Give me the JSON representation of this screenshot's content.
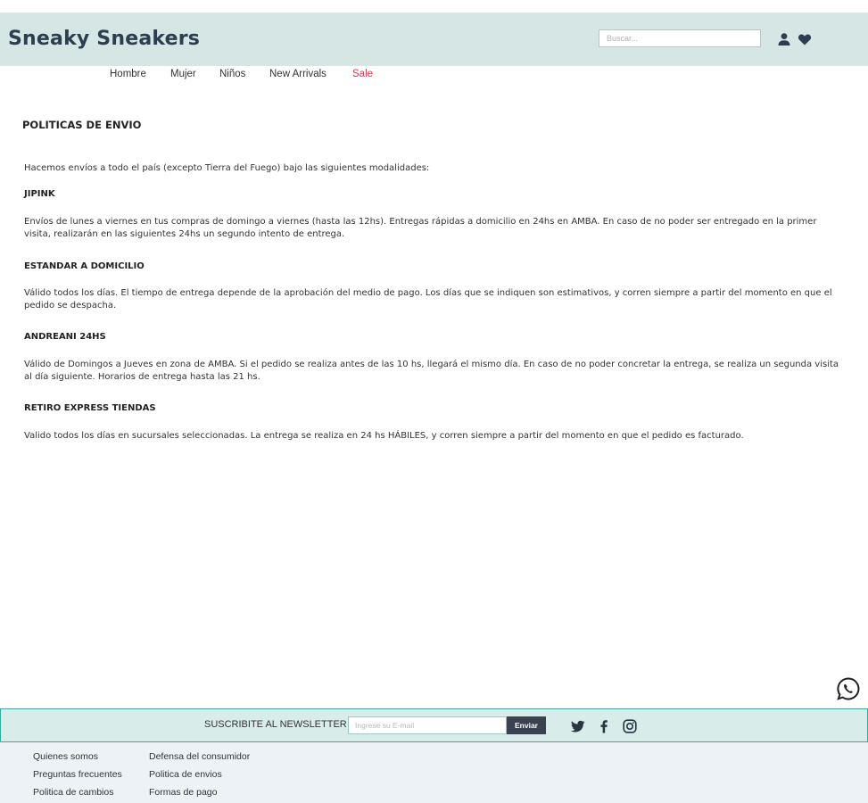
{
  "brand": "Sneaky Sneakers",
  "search": {
    "placeholder": "Buscar..."
  },
  "nav": [
    "Hombre",
    "Mujer",
    "Niños",
    "New Arrivals",
    "Sale"
  ],
  "page": {
    "title": "POLITICAS DE ENVIO",
    "intro": "Hacemos envíos a todo el país (excepto Tierra del Fuego) bajo las siguientes modalidades:",
    "sections": [
      {
        "heading": "JIPINK",
        "text": "Envíos de lunes a viernes en tus compras de domingo a viernes (hasta las 12hs). Entregas rápidas a domicilio en 24hs en AMBA. En caso de no poder ser entregado en la primer visita, realizarán en las siguientes 24hs un segundo intento de entrega."
      },
      {
        "heading": "ESTANDAR A DOMICILIO",
        "text": "Válido todos los días. El tiempo de entrega depende de la aprobación del medio de pago. Los días que se indiquen son estimativos, y corren siempre a partir del momento en que el pedido se despacha."
      },
      {
        "heading": "ANDREANI 24HS",
        "text": "Válido de Domingos a Jueves en zona de AMBA. Si el pedido se realiza antes de las 10 hs, llegará el mismo día. En caso de no poder concretar la entrega, se realiza un segunda visita al día siguiente. Horarios de entrega hasta las 21 hs."
      },
      {
        "heading": "RETIRO EXPRESS TIENDAS",
        "text": "Valido todos los días en sucursales seleccionadas. La entrega se realiza en 24 hs HÁBILES, y corren siempre a partir del momento en que el pedido es facturado."
      }
    ]
  },
  "newsletter": {
    "label": "SUSCRIBITE AL NEWSLETTER",
    "placeholder": "Ingrese su E-mail",
    "button": "Enviar"
  },
  "footer": {
    "col1": [
      "Quienes somos",
      "Preguntas frecuentes",
      "Politica de cambios"
    ],
    "col2": [
      "Defensa del consumidor",
      "Politica de envios",
      "Formas de pago"
    ]
  },
  "colors": {
    "header_bg": "#d5e6e4",
    "newsletter_bg": "#d8ecea",
    "newsletter_border": "#3aa99f",
    "sale": "#d13a4a",
    "footer_bg": "#ecf2f6"
  },
  "icons": [
    "user-icon",
    "heart-icon",
    "twitter-icon",
    "facebook-icon",
    "instagram-icon",
    "whatsapp-icon"
  ]
}
